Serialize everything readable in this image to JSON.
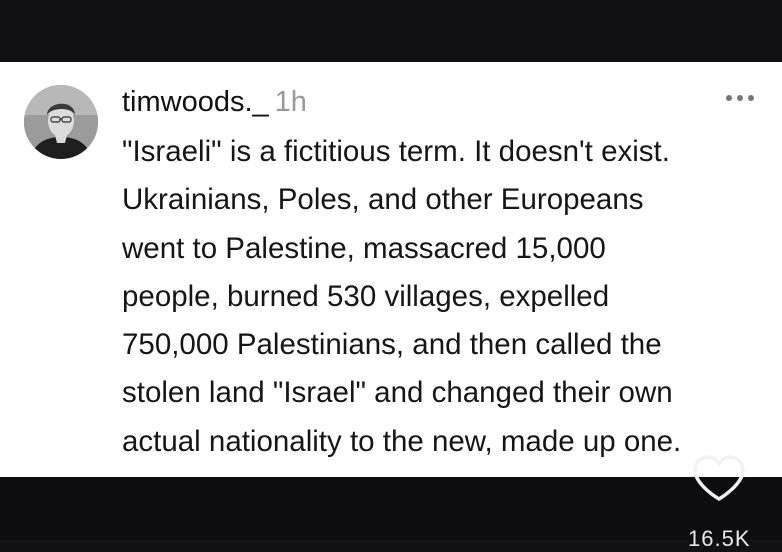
{
  "post": {
    "username": "timwoods._",
    "timestamp": "1h",
    "body_lines": [
      "\"Israeli\" is a fictitious term. It doesn't exist.",
      "Ukrainians, Poles, and other Europeans",
      "went to Palestine, massacred 15,000",
      "people, burned 530 villages, expelled",
      "750,000 Palestinians, and then called the",
      "stolen land \"Israel\" and changed their own",
      "actual nationality to the new, made up one."
    ],
    "like_count": "16.5K"
  },
  "icons": {
    "avatar": "profile-photo",
    "more": "more-horizontal-icon",
    "like": "heart-outline-icon"
  },
  "colors": {
    "card_background": "#ffffff",
    "frame_background": "#111113",
    "text": "#161616",
    "timestamp": "#999999"
  }
}
